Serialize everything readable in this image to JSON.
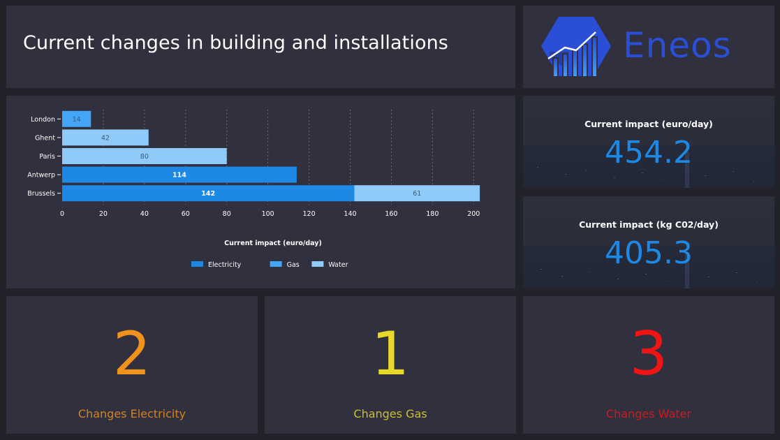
{
  "header": {
    "title": "Current changes in building and installations"
  },
  "logo": {
    "text": "Eneos",
    "color": "#2a4fd6"
  },
  "kpis": {
    "euro": {
      "label": "Current impact (euro/day)",
      "value": "454.2"
    },
    "co2": {
      "label": "Current impact (kg C02/day)",
      "value": "405.3"
    }
  },
  "counts": {
    "electricity": {
      "value": "2",
      "label": "Changes Electricity",
      "color": "#f0921e"
    },
    "gas": {
      "value": "1",
      "label": "Changes Gas",
      "color": "#e8d82a"
    },
    "water": {
      "value": "3",
      "label": "Changes Water",
      "color": "#f01414"
    }
  },
  "chart_data": {
    "type": "bar",
    "orientation": "horizontal",
    "stacked": true,
    "categories": [
      "London",
      "Ghent",
      "Paris",
      "Antwerp",
      "Brussels"
    ],
    "series": [
      {
        "name": "Electricity",
        "color": "#1e88e5",
        "values": [
          0,
          0,
          0,
          114,
          142
        ]
      },
      {
        "name": "Gas",
        "color": "#42a5f5",
        "values": [
          14,
          0,
          0,
          0,
          0
        ]
      },
      {
        "name": "Water",
        "color": "#90caf9",
        "values": [
          0,
          42,
          80,
          0,
          61
        ]
      }
    ],
    "xlabel": "Current impact (euro/day)",
    "xlim": [
      0,
      205
    ],
    "xticks": [
      0,
      20,
      40,
      60,
      80,
      100,
      120,
      140,
      160,
      180,
      200
    ],
    "grid": "vertical dashed",
    "legend": "bottom-center"
  }
}
